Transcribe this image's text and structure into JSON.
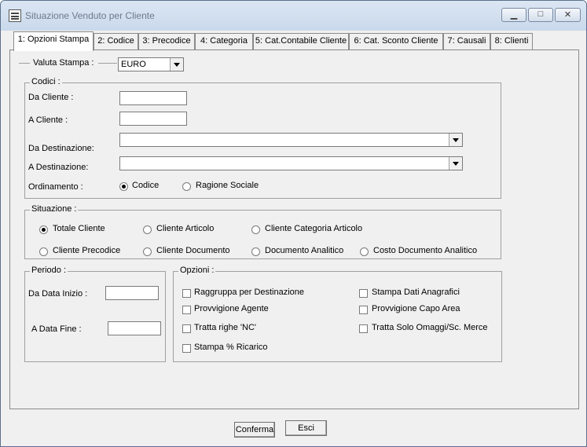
{
  "window": {
    "title": "Situazione Venduto per Cliente",
    "min": "▁",
    "max": "□",
    "close": "✕"
  },
  "tabs": [
    {
      "label": "1: Opzioni Stampa"
    },
    {
      "label": "2: Codice"
    },
    {
      "label": "3: Precodice"
    },
    {
      "label": "4: Categoria"
    },
    {
      "label": "5: Cat.Contabile Cliente"
    },
    {
      "label": "6: Cat. Sconto Cliente"
    },
    {
      "label": "7: Causali"
    },
    {
      "label": "8: Clienti"
    }
  ],
  "valuta": {
    "label": "Valuta Stampa :",
    "value": "EURO"
  },
  "codici": {
    "title": "Codici :",
    "da_cliente": "Da Cliente :",
    "a_cliente": "A Cliente :",
    "da_destinazione": "Da Destinazione:",
    "a_destinazione": "A Destinazione:",
    "ordinamento": "Ordinamento :",
    "opt_codice": "Codice",
    "opt_ragione": "Ragione Sociale"
  },
  "situazione": {
    "title": "Situazione :",
    "options": [
      "Totale Cliente",
      "Cliente Articolo",
      "Cliente Categoria Articolo",
      "Cliente Precodice",
      "Cliente Documento",
      "Documento Analitico",
      "Costo Documento Analitico"
    ]
  },
  "periodo": {
    "title": "Periodo :",
    "da_data": "Da Data Inizio :",
    "a_data": "A Data Fine :"
  },
  "opzioni": {
    "title": "Opzioni :",
    "items": [
      "Raggruppa per Destinazione",
      "Provvigione Agente",
      "Tratta righe 'NC'",
      "Stampa % Ricarico",
      "Stampa Dati Anagrafici",
      "Provvigione Capo Area",
      "Tratta Solo Omaggi/Sc. Merce"
    ]
  },
  "buttons": {
    "confirm": "Conferma",
    "exit": "Esci"
  }
}
